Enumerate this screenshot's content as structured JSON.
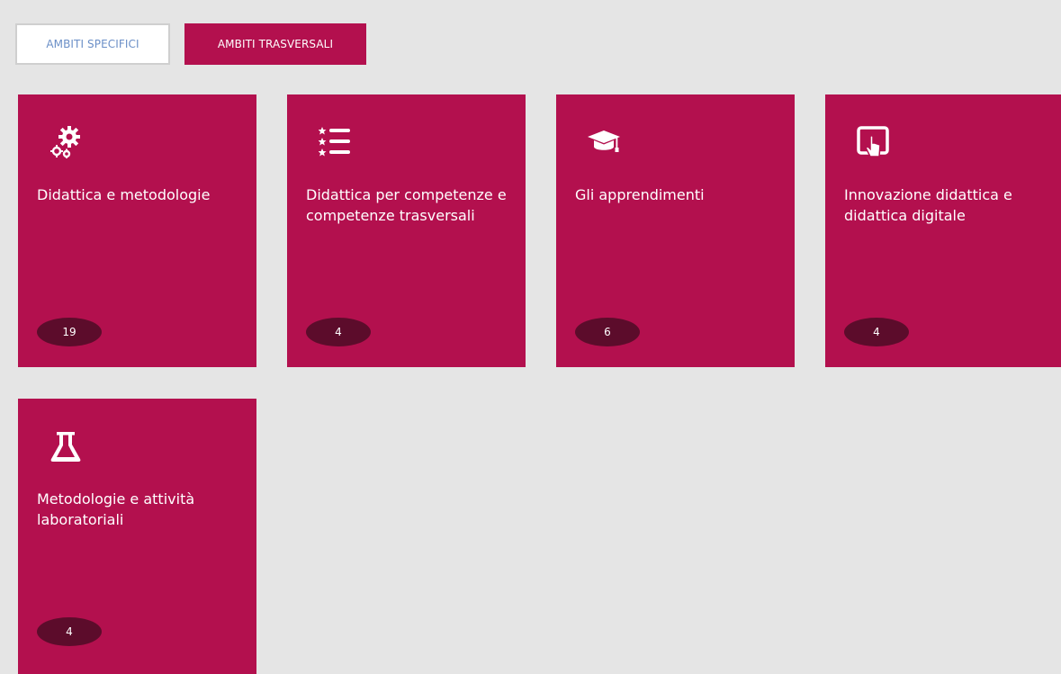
{
  "tabs": {
    "specific_label": "AMBITI SPECIFICI",
    "transversal_label": "AMBITI TRASVERSALI"
  },
  "cards": [
    {
      "title": "Didattica e metodologie",
      "count": "19",
      "icon": "gears-icon"
    },
    {
      "title": "Didattica per competenze e competenze trasversali",
      "count": "4",
      "icon": "list-icon"
    },
    {
      "title": "Gli apprendimenti",
      "count": "6",
      "icon": "graduation-cap-icon"
    },
    {
      "title": "Innovazione didattica e didattica digitale",
      "count": "4",
      "icon": "tablet-touch-icon"
    },
    {
      "title": "Metodologie e attività laboratoriali",
      "count": "4",
      "icon": "flask-icon"
    }
  ],
  "colors": {
    "card_bg": "#b3104e",
    "badge_bg": "#5c0c2b",
    "page_bg": "#e5e5e5",
    "inactive_tab_text": "#6b8fc7"
  }
}
